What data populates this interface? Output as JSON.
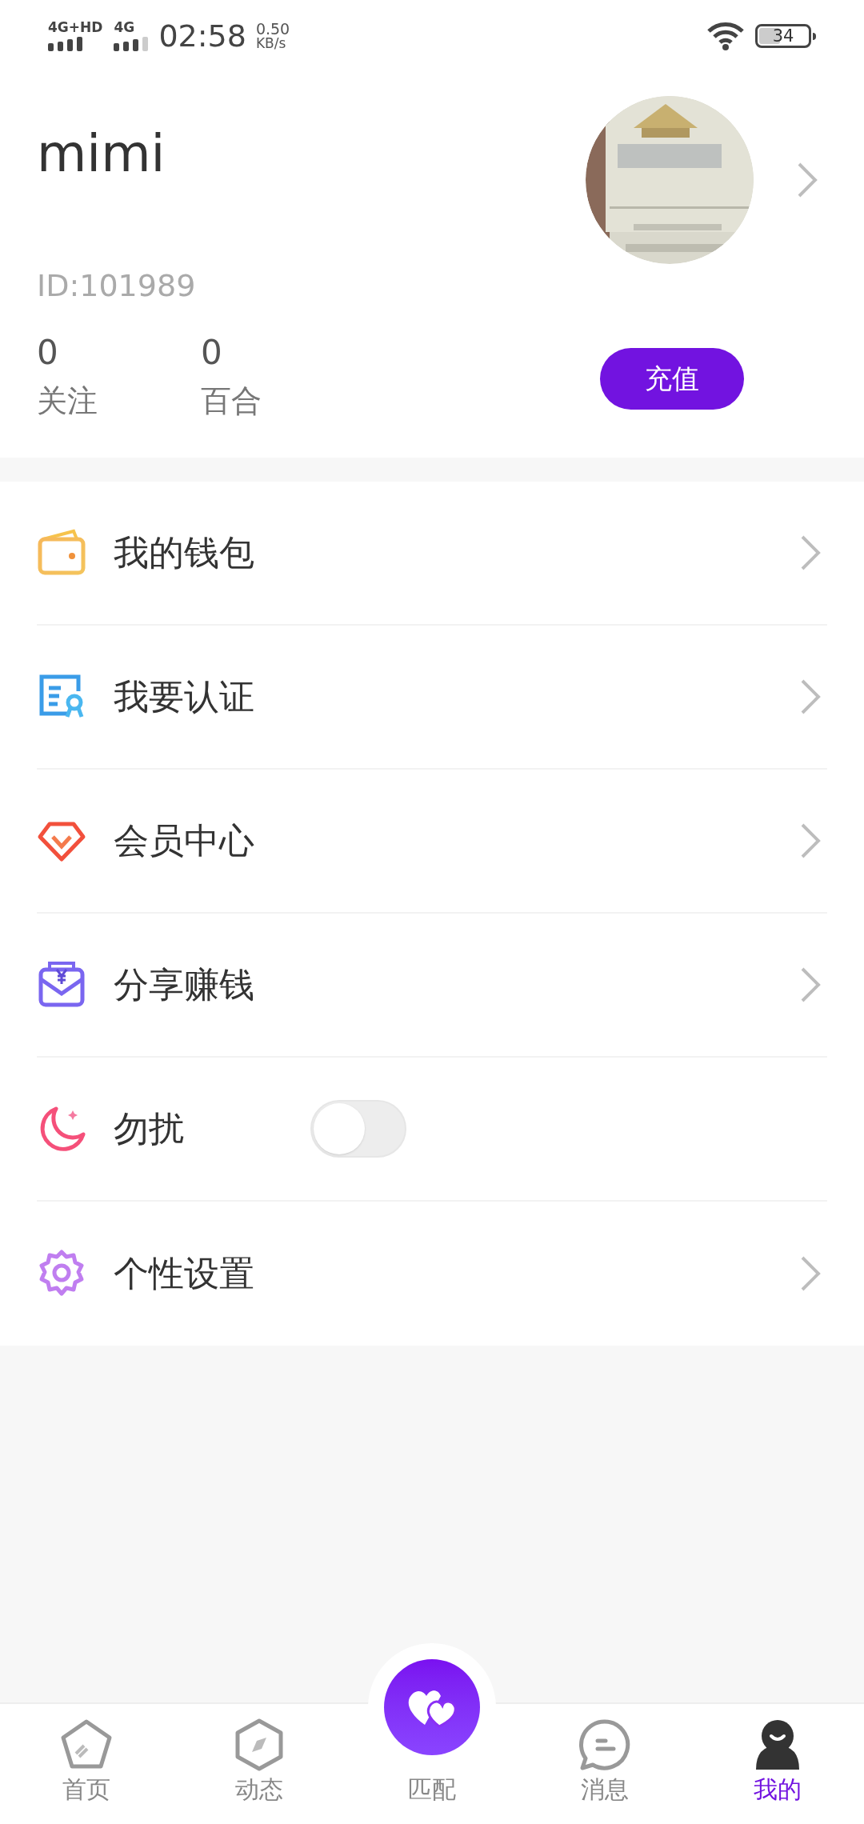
{
  "status_bar": {
    "network_1": "4G+HD",
    "network_2": "4G",
    "time": "02:58",
    "speed_value": "0.50",
    "speed_unit": "KB/s",
    "battery": "34"
  },
  "profile": {
    "name": "mimi",
    "id": "ID:101989",
    "stats": [
      {
        "value": "0",
        "label": "关注"
      },
      {
        "value": "0",
        "label": "百合"
      }
    ],
    "recharge_button": "充值"
  },
  "menu": [
    {
      "kind": "link",
      "label": "我的钱包"
    },
    {
      "kind": "link",
      "label": "我要认证"
    },
    {
      "kind": "link",
      "label": "会员中心"
    },
    {
      "kind": "link",
      "label": "分享赚钱"
    },
    {
      "kind": "toggle",
      "label": "勿扰",
      "on": false
    },
    {
      "kind": "link",
      "label": "个性设置"
    }
  ],
  "bottom_nav": [
    {
      "label": "首页",
      "selected": false
    },
    {
      "label": "动态",
      "selected": false
    },
    {
      "label": "匹配",
      "selected": false
    },
    {
      "label": "消息",
      "selected": false
    },
    {
      "label": "我的",
      "selected": true
    }
  ]
}
